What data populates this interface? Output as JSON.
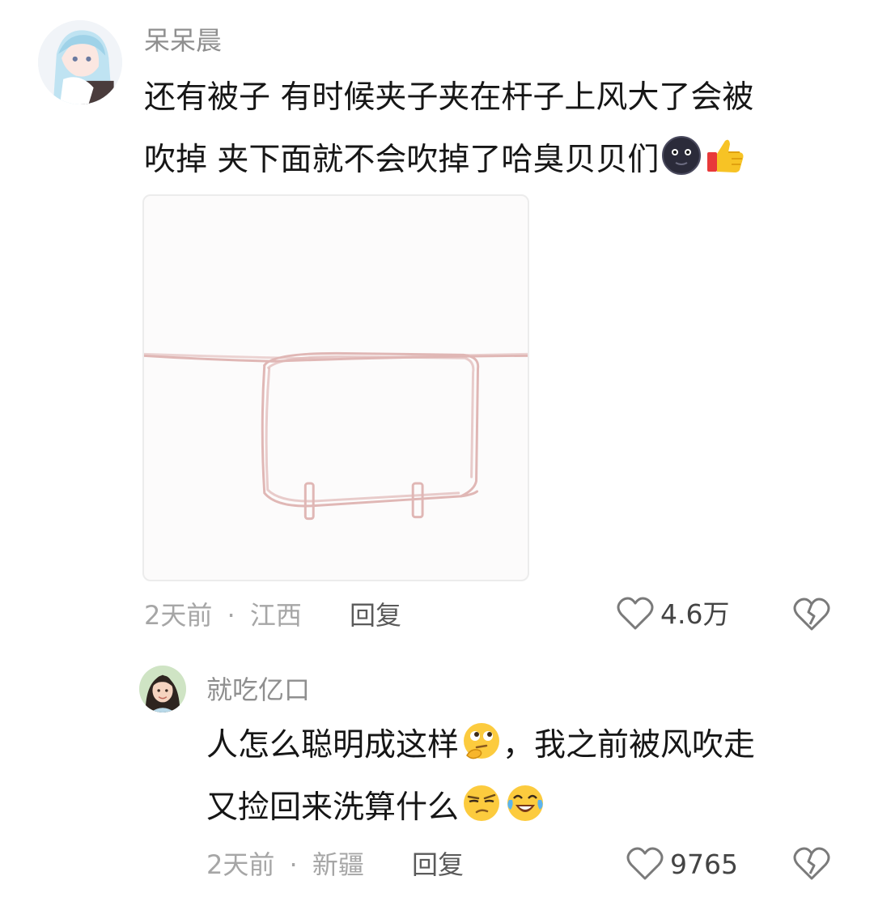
{
  "comments": [
    {
      "username": "呆呆晨",
      "lines": [
        "还有被子  有时候夹子夹在杆子上风大了会被",
        "吹掉  夹下面就不会吹掉了哈臭贝贝们"
      ],
      "emojis": [
        "dark-moon-face-emoji",
        "thumbs-up-emoji"
      ],
      "time": "2天前",
      "separator": "·",
      "location": "江西",
      "reply_label": "回复",
      "likes": "4.6万",
      "image": "drawing-of-blanket-on-pole"
    },
    {
      "username": "就吃亿口",
      "lines": [
        "人怎么聪明成这样",
        "，我之前被风吹走",
        "又捡回来洗算什么"
      ],
      "emojis": [
        "thinking-face-emoji",
        "skeptical-face-emoji",
        "laughing-crying-face-emoji"
      ],
      "time": "2天前",
      "separator": "·",
      "location": "新疆",
      "reply_label": "回复",
      "likes": "9765"
    }
  ],
  "icons": {
    "like": "heart-outline-icon",
    "dislike": "broken-heart-icon"
  },
  "colors": {
    "sketch": "#e0b7b5",
    "meta": "#a6a6a6",
    "text": "#161616"
  }
}
